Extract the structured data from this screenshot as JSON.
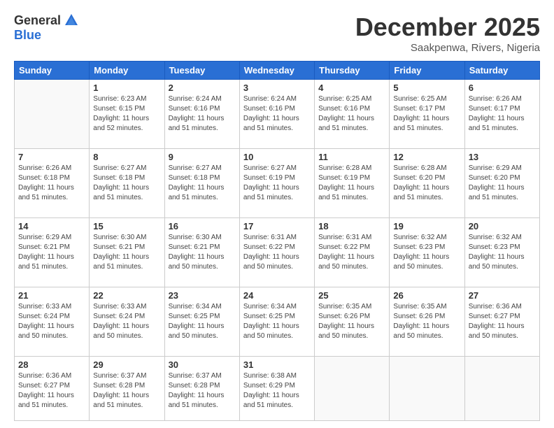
{
  "logo": {
    "general": "General",
    "blue": "Blue"
  },
  "title": "December 2025",
  "location": "Saakpenwa, Rivers, Nigeria",
  "weekdays": [
    "Sunday",
    "Monday",
    "Tuesday",
    "Wednesday",
    "Thursday",
    "Friday",
    "Saturday"
  ],
  "weeks": [
    [
      {
        "day": "",
        "info": ""
      },
      {
        "day": "1",
        "info": "Sunrise: 6:23 AM\nSunset: 6:15 PM\nDaylight: 11 hours\nand 52 minutes."
      },
      {
        "day": "2",
        "info": "Sunrise: 6:24 AM\nSunset: 6:16 PM\nDaylight: 11 hours\nand 51 minutes."
      },
      {
        "day": "3",
        "info": "Sunrise: 6:24 AM\nSunset: 6:16 PM\nDaylight: 11 hours\nand 51 minutes."
      },
      {
        "day": "4",
        "info": "Sunrise: 6:25 AM\nSunset: 6:16 PM\nDaylight: 11 hours\nand 51 minutes."
      },
      {
        "day": "5",
        "info": "Sunrise: 6:25 AM\nSunset: 6:17 PM\nDaylight: 11 hours\nand 51 minutes."
      },
      {
        "day": "6",
        "info": "Sunrise: 6:26 AM\nSunset: 6:17 PM\nDaylight: 11 hours\nand 51 minutes."
      }
    ],
    [
      {
        "day": "7",
        "info": "Sunrise: 6:26 AM\nSunset: 6:18 PM\nDaylight: 11 hours\nand 51 minutes."
      },
      {
        "day": "8",
        "info": "Sunrise: 6:27 AM\nSunset: 6:18 PM\nDaylight: 11 hours\nand 51 minutes."
      },
      {
        "day": "9",
        "info": "Sunrise: 6:27 AM\nSunset: 6:18 PM\nDaylight: 11 hours\nand 51 minutes."
      },
      {
        "day": "10",
        "info": "Sunrise: 6:27 AM\nSunset: 6:19 PM\nDaylight: 11 hours\nand 51 minutes."
      },
      {
        "day": "11",
        "info": "Sunrise: 6:28 AM\nSunset: 6:19 PM\nDaylight: 11 hours\nand 51 minutes."
      },
      {
        "day": "12",
        "info": "Sunrise: 6:28 AM\nSunset: 6:20 PM\nDaylight: 11 hours\nand 51 minutes."
      },
      {
        "day": "13",
        "info": "Sunrise: 6:29 AM\nSunset: 6:20 PM\nDaylight: 11 hours\nand 51 minutes."
      }
    ],
    [
      {
        "day": "14",
        "info": "Sunrise: 6:29 AM\nSunset: 6:21 PM\nDaylight: 11 hours\nand 51 minutes."
      },
      {
        "day": "15",
        "info": "Sunrise: 6:30 AM\nSunset: 6:21 PM\nDaylight: 11 hours\nand 51 minutes."
      },
      {
        "day": "16",
        "info": "Sunrise: 6:30 AM\nSunset: 6:21 PM\nDaylight: 11 hours\nand 50 minutes."
      },
      {
        "day": "17",
        "info": "Sunrise: 6:31 AM\nSunset: 6:22 PM\nDaylight: 11 hours\nand 50 minutes."
      },
      {
        "day": "18",
        "info": "Sunrise: 6:31 AM\nSunset: 6:22 PM\nDaylight: 11 hours\nand 50 minutes."
      },
      {
        "day": "19",
        "info": "Sunrise: 6:32 AM\nSunset: 6:23 PM\nDaylight: 11 hours\nand 50 minutes."
      },
      {
        "day": "20",
        "info": "Sunrise: 6:32 AM\nSunset: 6:23 PM\nDaylight: 11 hours\nand 50 minutes."
      }
    ],
    [
      {
        "day": "21",
        "info": "Sunrise: 6:33 AM\nSunset: 6:24 PM\nDaylight: 11 hours\nand 50 minutes."
      },
      {
        "day": "22",
        "info": "Sunrise: 6:33 AM\nSunset: 6:24 PM\nDaylight: 11 hours\nand 50 minutes."
      },
      {
        "day": "23",
        "info": "Sunrise: 6:34 AM\nSunset: 6:25 PM\nDaylight: 11 hours\nand 50 minutes."
      },
      {
        "day": "24",
        "info": "Sunrise: 6:34 AM\nSunset: 6:25 PM\nDaylight: 11 hours\nand 50 minutes."
      },
      {
        "day": "25",
        "info": "Sunrise: 6:35 AM\nSunset: 6:26 PM\nDaylight: 11 hours\nand 50 minutes."
      },
      {
        "day": "26",
        "info": "Sunrise: 6:35 AM\nSunset: 6:26 PM\nDaylight: 11 hours\nand 50 minutes."
      },
      {
        "day": "27",
        "info": "Sunrise: 6:36 AM\nSunset: 6:27 PM\nDaylight: 11 hours\nand 50 minutes."
      }
    ],
    [
      {
        "day": "28",
        "info": "Sunrise: 6:36 AM\nSunset: 6:27 PM\nDaylight: 11 hours\nand 51 minutes."
      },
      {
        "day": "29",
        "info": "Sunrise: 6:37 AM\nSunset: 6:28 PM\nDaylight: 11 hours\nand 51 minutes."
      },
      {
        "day": "30",
        "info": "Sunrise: 6:37 AM\nSunset: 6:28 PM\nDaylight: 11 hours\nand 51 minutes."
      },
      {
        "day": "31",
        "info": "Sunrise: 6:38 AM\nSunset: 6:29 PM\nDaylight: 11 hours\nand 51 minutes."
      },
      {
        "day": "",
        "info": ""
      },
      {
        "day": "",
        "info": ""
      },
      {
        "day": "",
        "info": ""
      }
    ]
  ]
}
